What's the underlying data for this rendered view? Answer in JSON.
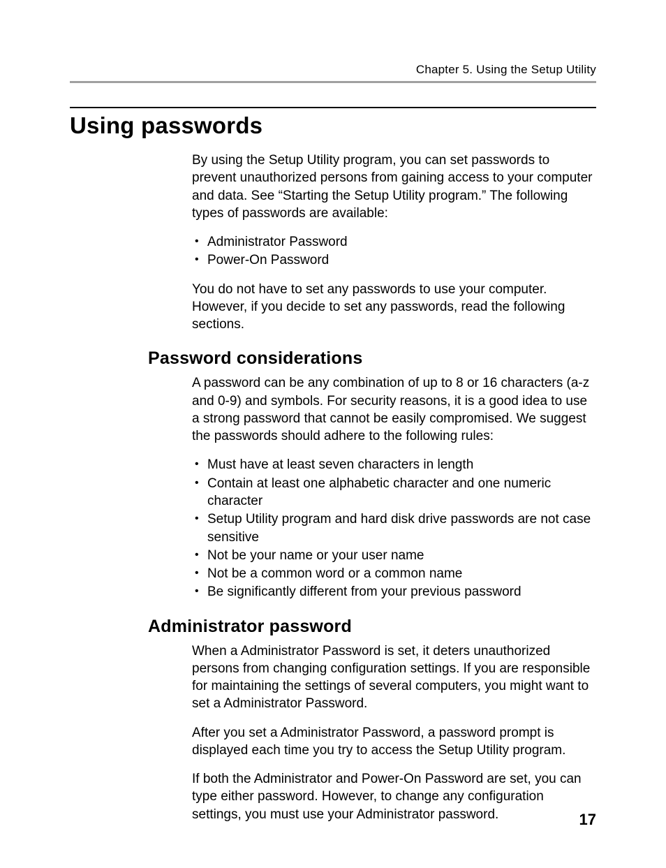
{
  "runningHead": "Chapter 5. Using the Setup Utility",
  "pageNumber": "17",
  "section": {
    "title": "Using passwords",
    "intro1": "By using the Setup Utility program, you can set passwords to prevent unauthorized persons from gaining access to your computer and data. See “Starting the Setup Utility program.” The following types of passwords are available:",
    "introBullets": [
      "Administrator Password",
      "Power-On Password"
    ],
    "intro2": "You do not have to set any passwords to use your computer. However, if you decide to set any passwords, read the following sections."
  },
  "sub1": {
    "title": "Password considerations",
    "para1": "A password can be any combination of up to 8 or 16 characters (a-z and 0-9) and symbols. For security reasons, it is a good idea to use a strong password that cannot be easily compromised. We suggest the passwords should adhere to the following rules:",
    "bullets": [
      "Must have at least seven characters in length",
      "Contain at least one alphabetic character and one numeric character",
      "Setup Utility program and hard disk drive passwords are not case sensitive",
      "Not be your name or your user name",
      "Not be a common word or a common name",
      "Be significantly different from your previous password"
    ]
  },
  "sub2": {
    "title": "Administrator password",
    "para1": "When a Administrator Password is set, it deters unauthorized persons from changing configuration settings. If you are responsible for maintaining the settings of several computers, you might want to set a Administrator Password.",
    "para2": "After you set a Administrator Password, a password prompt is displayed each time you try to access the Setup Utility program.",
    "para3": "If both the Administrator and Power-On Password are set, you can type either password. However, to change any configuration settings, you must use your Administrator password."
  }
}
